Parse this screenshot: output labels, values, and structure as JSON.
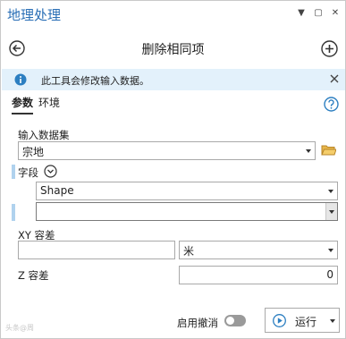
{
  "app": {
    "title": "地理处理"
  },
  "window_controls": {
    "pin": "▼",
    "dock": "▢",
    "close": "✕"
  },
  "tool": {
    "title": "删除相同项"
  },
  "info_bar": {
    "message": "此工具会修改输入数据。"
  },
  "tabs": [
    {
      "label": "参数",
      "active": true
    },
    {
      "label": "环境",
      "active": false
    }
  ],
  "params": {
    "input_dataset": {
      "label": "输入数据集",
      "value": "宗地"
    },
    "fields": {
      "label": "字段",
      "rows": [
        "Shape",
        ""
      ]
    },
    "xy_tolerance": {
      "label": "XY 容差",
      "value": "",
      "unit": "米"
    },
    "z_tolerance": {
      "label": "Z 容差",
      "value": "0"
    }
  },
  "footer": {
    "undo_label": "启用撤消",
    "undo_enabled": false,
    "run_label": "运行"
  },
  "watermark": "头条@周"
}
